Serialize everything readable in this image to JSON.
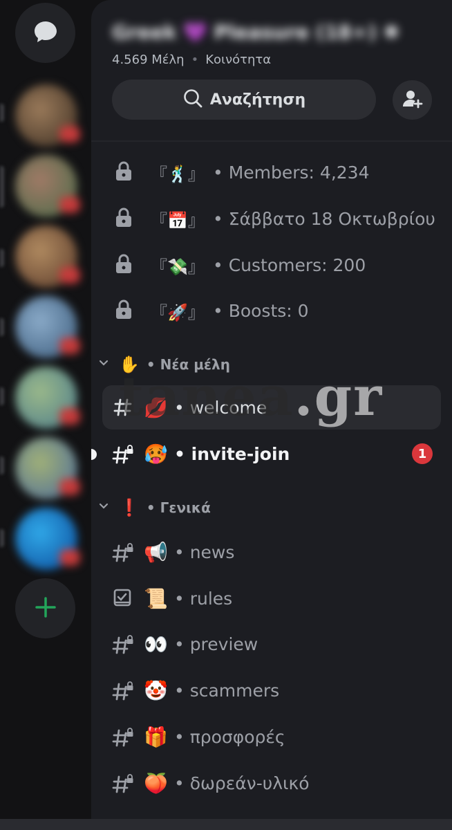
{
  "rail": {
    "dm_icon": "chat-bubble-icon",
    "add_server_icon": "plus-icon",
    "servers": [
      {
        "color": "#7a5a3c"
      },
      {
        "color": "#5c7a58"
      },
      {
        "color": "#8a6a48"
      },
      {
        "color": "#4a6a8a"
      },
      {
        "color": "#6a8a5a"
      },
      {
        "color": "#6a7a5a"
      },
      {
        "color": "#1a8acc"
      }
    ]
  },
  "header": {
    "member_count": "4.569 Μέλη",
    "separator": "•",
    "community": "Κοινότητα",
    "search_label": "Αναζήτηση",
    "invite_icon": "add-member-icon"
  },
  "stats": [
    {
      "emoji": "🕺",
      "text": "• Members: 4,234"
    },
    {
      "emoji": "📅",
      "text": "• Σάββατο 18 Οκτωβρίου"
    },
    {
      "emoji": "💸",
      "text": "• Customers: 200"
    },
    {
      "emoji": "🚀",
      "text": "• Boosts: 0"
    }
  ],
  "categories": [
    {
      "emoji": "✋",
      "label": "• Νέα μέλη",
      "channels": [
        {
          "icon": "hash-icon",
          "emoji": "💋",
          "name": "• welcome",
          "selected": true
        },
        {
          "icon": "hash-lock-icon",
          "emoji": "🥵",
          "name": "• invite-join",
          "unread": true,
          "mentions": "1"
        }
      ]
    },
    {
      "emoji": "❗",
      "label": "• Γενικά",
      "channels": [
        {
          "icon": "hash-lock-icon",
          "emoji": "📢",
          "name": "• news"
        },
        {
          "icon": "rules-icon",
          "emoji": "📜",
          "name": "• rules"
        },
        {
          "icon": "hash-lock-icon",
          "emoji": "👀",
          "name": "• preview"
        },
        {
          "icon": "hash-lock-icon",
          "emoji": "🤡",
          "name": "• scammers"
        },
        {
          "icon": "hash-lock-icon",
          "emoji": "🎁",
          "name": "• προσφορές"
        },
        {
          "icon": "hash-lock-icon",
          "emoji": "🍑",
          "name": "• δωρεάν-υλικό"
        }
      ]
    }
  ],
  "watermark": {
    "part1": "tanea",
    "part2": ".gr"
  },
  "brand_colors": {
    "mention": "#da373c",
    "add_server": "#23a55a"
  }
}
